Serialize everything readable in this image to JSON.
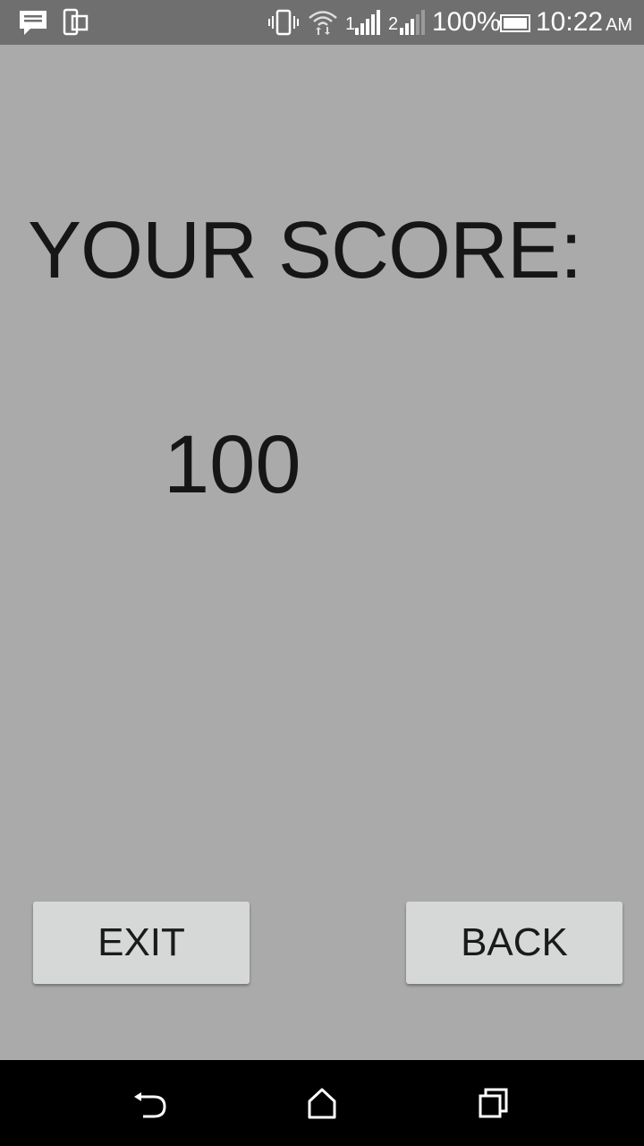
{
  "status_bar": {
    "battery_percent": "100%",
    "time": "10:22",
    "ampm": "AM",
    "sim1_label": "1",
    "sim2_label": "2",
    "icons": [
      "message-icon",
      "phone-screen-icon",
      "vibrate-icon",
      "wifi-icon",
      "signal-sim1-icon",
      "signal-sim2-icon",
      "battery-icon"
    ]
  },
  "main": {
    "score_label": "YOUR SCORE:",
    "score_value": "100"
  },
  "buttons": {
    "exit_label": "EXIT",
    "back_label": "BACK"
  },
  "nav_bar": {
    "icons": [
      "back-nav-icon",
      "home-nav-icon",
      "recents-nav-icon"
    ]
  },
  "colors": {
    "background": "#aaaaaa",
    "status_bar": "#6f6f6f",
    "button": "#d6d7d7",
    "text": "#161616",
    "nav_bar": "#000000"
  }
}
